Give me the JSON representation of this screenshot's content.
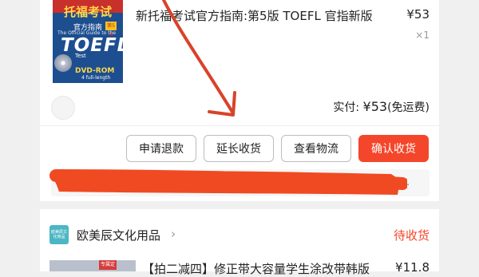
{
  "order1": {
    "product": {
      "cover": {
        "title_cn": "托福考试",
        "subtitle_cn": "官方指南",
        "edition_badge": "第5版",
        "en_line": "The Official Guide to the",
        "brand": "TOEFL",
        "test_label": "Test",
        "media": "DVD-ROM",
        "media_sub": "4 full-length"
      },
      "title": "新托福考试官方指南:第5版 TOEFL 官指新版",
      "price": "¥53",
      "quantity": "×1"
    },
    "payment": {
      "label": "实付:",
      "amount": "¥53",
      "note": "(免运费)"
    },
    "actions": {
      "refund": "申请退款",
      "extend": "延长收货",
      "logistics": "查看物流",
      "confirm": "确认收货"
    },
    "info_more": "..."
  },
  "order2": {
    "shop": {
      "logo_text": "欧美辰文化用品",
      "name": "欧美辰文化用品",
      "chevron": "›",
      "status": "待收货"
    },
    "product": {
      "thumb_badge": "专属定制",
      "title": "【拍二减四】修正带大容量学生涂改带韩版",
      "price": "¥11.8"
    }
  },
  "colors": {
    "accent": "#f4462a",
    "status": "#f4462a",
    "scribble": "#f04a22",
    "arrow": "#d8432a"
  }
}
